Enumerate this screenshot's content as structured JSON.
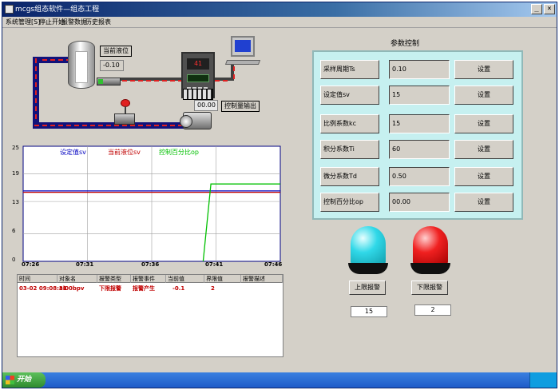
{
  "window": {
    "title": "mcgs组态软件—组态工程"
  },
  "menu": [
    "系统管理[S]",
    "停止开始",
    "报警数据",
    "历史报表"
  ],
  "window_buttons": {
    "minimize": "_",
    "close": "×"
  },
  "process": {
    "level_label": "当前液位",
    "level_value": "-0.10",
    "controller_display": "41",
    "output_value": "00.00",
    "output_label": "控制量输出"
  },
  "chart_data": {
    "type": "line",
    "x": [
      "07:26",
      "07:31",
      "07:36",
      "07:41",
      "07:46"
    ],
    "ylim": [
      0,
      25
    ],
    "yticks": [
      0,
      6,
      13,
      19,
      25
    ],
    "legend": [
      "设定值sv",
      "当前液位sv",
      "控制百分比op"
    ],
    "colors": {
      "setpoint": "#0000c0",
      "level": "#c00000",
      "output": "#00c000"
    },
    "series": [
      {
        "name": "设定值sv",
        "points": [
          [
            0,
            15.3
          ],
          [
            1,
            15.3
          ]
        ]
      },
      {
        "name": "当前液位sv",
        "points": [
          [
            0,
            15.0
          ],
          [
            1,
            15.0
          ]
        ]
      },
      {
        "name": "控制百分比op",
        "points": [
          [
            0.7,
            0
          ],
          [
            0.73,
            16.8
          ],
          [
            1,
            16.8
          ]
        ]
      }
    ]
  },
  "alarm_table": {
    "headers": [
      "时间",
      "对象名",
      "报警类型",
      "报警事件",
      "当前值",
      "界限值",
      "报警描述"
    ],
    "rows": [
      [
        "03-02 09:08:31",
        "ai00bpv",
        "下限报警",
        "报警产生",
        "-0.1",
        "2",
        ""
      ]
    ]
  },
  "pid": {
    "title": "参数控制",
    "rows": [
      {
        "label": "采样周期Ts",
        "value": "0.10",
        "button": "设置"
      },
      {
        "label": "设定值sv",
        "value": "15",
        "button": "设置"
      },
      {
        "label": "比例系数kc",
        "value": "15",
        "button": "设置"
      },
      {
        "label": "积分系数Ti",
        "value": "60",
        "button": "设置"
      },
      {
        "label": "微分系数Td",
        "value": "0.50",
        "button": "设置"
      },
      {
        "label": "控制百分比op",
        "value": "00.00",
        "button": "设置"
      }
    ]
  },
  "alarms": {
    "upper_label": "上限报警",
    "upper_value": "15",
    "lower_label": "下限报警",
    "lower_value": "2"
  },
  "taskbar": {
    "start_label": "开始"
  }
}
